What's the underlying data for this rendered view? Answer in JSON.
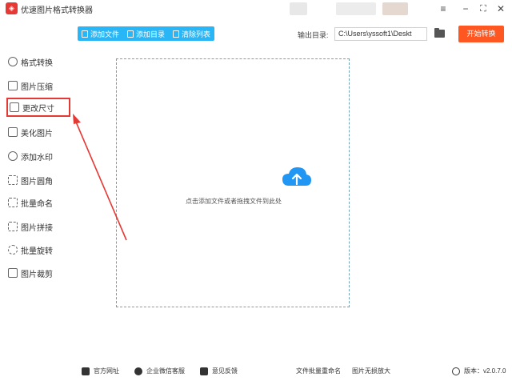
{
  "window": {
    "title": "优速图片格式转换器",
    "controls": {
      "menu": "≡",
      "minimize": "−",
      "maximize": "⛶",
      "close": "✕"
    }
  },
  "toolbar": {
    "add_file": "添加文件",
    "add_folder": "添加目录",
    "clear_list": "清除列表",
    "output_label": "输出目录:",
    "output_path": "C:\\Users\\yssoft1\\Deskt",
    "start": "开始转换"
  },
  "sidebar": {
    "items": [
      {
        "label": "格式转换",
        "icon": "format-convert-icon"
      },
      {
        "label": "图片压缩",
        "icon": "compress-icon"
      },
      {
        "label": "更改尺寸",
        "icon": "resize-icon",
        "active": true
      },
      {
        "label": "美化图片",
        "icon": "beautify-icon"
      },
      {
        "label": "添加水印",
        "icon": "watermark-icon"
      },
      {
        "label": "图片圆角",
        "icon": "rounded-corner-icon"
      },
      {
        "label": "批量命名",
        "icon": "batch-rename-icon"
      },
      {
        "label": "图片拼接",
        "icon": "stitch-icon"
      },
      {
        "label": "批量旋转",
        "icon": "rotate-icon"
      },
      {
        "label": "图片裁剪",
        "icon": "crop-icon"
      }
    ]
  },
  "dropzone": {
    "hint": "点击添加文件或者拖拽文件到此处",
    "icon": "cloud-upload-icon"
  },
  "footer": {
    "website": "官方网址",
    "wechat_support": "企业微信客服",
    "feedback": "意见反馈",
    "batch_rename": "文件批量重命名",
    "lossless_enlarge": "图片无损放大",
    "version": "版本：v2.0.7.0"
  },
  "colors": {
    "accent": "#29b6f6",
    "start_button": "#ff5722",
    "highlight": "#e53935"
  }
}
